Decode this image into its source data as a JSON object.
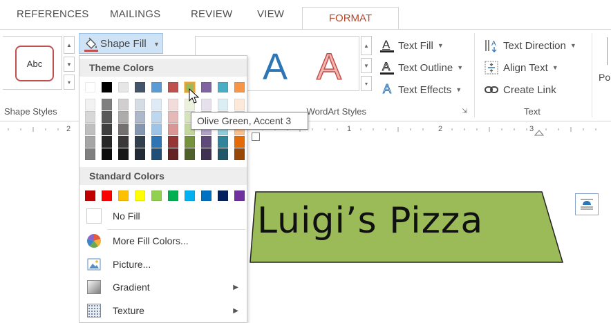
{
  "tabs": [
    {
      "label": "REFERENCES"
    },
    {
      "label": "MAILINGS"
    },
    {
      "label": "REVIEW"
    },
    {
      "label": "VIEW"
    },
    {
      "label": "FORMAT"
    }
  ],
  "ribbon": {
    "shape_styles": {
      "preview_label": "Abc",
      "group_label": "Shape Styles"
    },
    "shape_fill_label": "Shape Fill",
    "wordart": {
      "preview_letter": "A",
      "group_label": "WordArt Styles"
    },
    "text_fill": "Text Fill",
    "text_outline": "Text Outline",
    "text_effects": "Text Effects",
    "text_direction": "Text Direction",
    "align_text": "Align Text",
    "create_link": "Create Link",
    "text_group_label": "Text",
    "partial_right": "Po"
  },
  "ruler": {
    "numbers": [
      "2",
      "1",
      "2",
      "3"
    ]
  },
  "menu": {
    "theme_colors_header": "Theme Colors",
    "standard_colors_header": "Standard Colors",
    "theme_top_row": [
      "#ffffff",
      "#000000",
      "#e7e6e6",
      "#44546a",
      "#5b9bd5",
      "#c0504d",
      "#9bbb59",
      "#8064a2",
      "#4bacc6",
      "#f79646"
    ],
    "theme_shades": [
      [
        "#f2f2f2",
        "#7f7f7f",
        "#d0cece",
        "#d6dce4",
        "#deeaf6",
        "#f2dcdb",
        "#ebf1dd",
        "#e5e0ec",
        "#dbeef3",
        "#fde9d9"
      ],
      [
        "#d8d8d8",
        "#595959",
        "#aeabab",
        "#adb9ca",
        "#bdd7ee",
        "#e5b9b7",
        "#d7e3bc",
        "#ccc1d9",
        "#b7dde8",
        "#fbd5b5"
      ],
      [
        "#bfbfbf",
        "#3f3f3f",
        "#757070",
        "#8496b0",
        "#9dc3e6",
        "#d99694",
        "#c3d69b",
        "#b2a2c7",
        "#92cddc",
        "#fac08f"
      ],
      [
        "#a5a5a5",
        "#262626",
        "#3a3838",
        "#323f4f",
        "#2e75b5",
        "#953734",
        "#76923c",
        "#5f497a",
        "#31859b",
        "#e36c09"
      ],
      [
        "#7f7f7f",
        "#0c0c0c",
        "#171616",
        "#222a35",
        "#1f4e79",
        "#632423",
        "#4f6128",
        "#3f3151",
        "#205867",
        "#974806"
      ]
    ],
    "standard_colors": [
      "#c00000",
      "#ff0000",
      "#ffc000",
      "#ffff00",
      "#92d050",
      "#00b050",
      "#00b0f0",
      "#0070c0",
      "#002060",
      "#7030a0"
    ],
    "no_fill": "No Fill",
    "more_fill_colors": "More Fill Colors...",
    "picture": "Picture...",
    "gradient": "Gradient",
    "texture": "Texture"
  },
  "tooltip": {
    "text": "Olive Green, Accent 3"
  },
  "document": {
    "shape_text": "Luigi’s Pizza",
    "shape_fill": "#9bbb59"
  }
}
